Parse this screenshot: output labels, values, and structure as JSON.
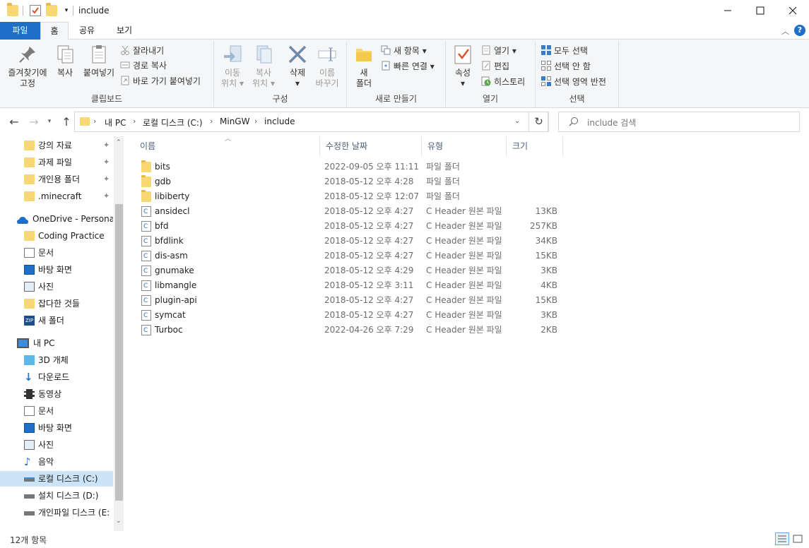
{
  "window": {
    "title": "include",
    "minimize_icon": "minimize-icon",
    "maximize_icon": "maximize-icon",
    "close_icon": "close-icon"
  },
  "ribbon_tabs": [
    {
      "label": "파일"
    },
    {
      "label": "홈"
    },
    {
      "label": "공유"
    },
    {
      "label": "보기"
    }
  ],
  "ribbon": {
    "clipboard": {
      "pin": "즐겨찾기에 고정",
      "pin_l1": "즐겨찾기에",
      "pin_l2": "고정",
      "copy": "복사",
      "paste": "붙여넣기",
      "cut": "잘라내기",
      "copy_path": "경로 복사",
      "paste_shortcut": "바로 가기 붙여넣기",
      "label": "클립보드"
    },
    "organize": {
      "move_l1": "이동",
      "move_l2": "위치",
      "copyto_l1": "복사",
      "copyto_l2": "위치",
      "delete": "삭제",
      "rename_l1": "이름",
      "rename_l2": "바꾸기",
      "label": "구성"
    },
    "new": {
      "folder_l1": "새",
      "folder_l2": "폴더",
      "new_item": "새 항목",
      "easy_access": "빠른 연결",
      "label": "새로 만들기"
    },
    "open": {
      "properties": "속성",
      "open": "열기",
      "edit": "편집",
      "history": "히스토리",
      "label": "열기"
    },
    "select": {
      "select_all": "모두 선택",
      "select_none": "선택 안 함",
      "invert": "선택 영역 반전",
      "label": "선택"
    }
  },
  "address": {
    "crumbs": [
      "내 PC",
      "로컬 디스크 (C:)",
      "MinGW",
      "include"
    ],
    "search_placeholder": "include 검색"
  },
  "nav": {
    "quick_access": [
      {
        "label": "강의 자료",
        "pinned": true
      },
      {
        "label": "과제 파일",
        "pinned": true
      },
      {
        "label": "개인용 폴더",
        "pinned": true
      },
      {
        "label": ".minecraft",
        "pinned": true
      }
    ],
    "onedrive": "OneDrive - Personal",
    "onedrive_items": [
      {
        "label": "Coding Practice",
        "icon": "folder-icon"
      },
      {
        "label": "문서",
        "icon": "document-icon"
      },
      {
        "label": "바탕 화면",
        "icon": "desktop-icon"
      },
      {
        "label": "사진",
        "icon": "pictures-icon"
      },
      {
        "label": "잡다한 것들",
        "icon": "folder-icon"
      },
      {
        "label": "새 폴더",
        "icon": "zip-folder-icon"
      }
    ],
    "this_pc": "내 PC",
    "pc_items": [
      {
        "label": "3D 개체",
        "icon": "3d-objects-icon"
      },
      {
        "label": "다운로드",
        "icon": "download-icon"
      },
      {
        "label": "동영상",
        "icon": "video-icon"
      },
      {
        "label": "문서",
        "icon": "document-icon"
      },
      {
        "label": "바탕 화면",
        "icon": "desktop-icon"
      },
      {
        "label": "사진",
        "icon": "pictures-icon"
      },
      {
        "label": "음악",
        "icon": "music-icon"
      },
      {
        "label": "로컬 디스크 (C:)",
        "icon": "drive-c-icon",
        "selected": true
      },
      {
        "label": "설치 디스크 (D:)",
        "icon": "drive-icon"
      },
      {
        "label": "개인파일 디스크 (E:",
        "icon": "drive-icon"
      }
    ]
  },
  "columns": {
    "name": "이름",
    "date": "수정한 날짜",
    "type": "유형",
    "size": "크기"
  },
  "files": [
    {
      "name": "bits",
      "date": "2022-09-05 오후 11:11",
      "type": "파일 폴더",
      "size": "",
      "kind": "folder"
    },
    {
      "name": "gdb",
      "date": "2018-05-12 오후 4:28",
      "type": "파일 폴더",
      "size": "",
      "kind": "folder"
    },
    {
      "name": "libiberty",
      "date": "2018-05-12 오후 12:07",
      "type": "파일 폴더",
      "size": "",
      "kind": "folder"
    },
    {
      "name": "ansidecl",
      "date": "2018-05-12 오후 4:27",
      "type": "C Header 원본 파일",
      "size": "13KB",
      "kind": "file"
    },
    {
      "name": "bfd",
      "date": "2018-05-12 오후 4:27",
      "type": "C Header 원본 파일",
      "size": "257KB",
      "kind": "file"
    },
    {
      "name": "bfdlink",
      "date": "2018-05-12 오후 4:27",
      "type": "C Header 원본 파일",
      "size": "34KB",
      "kind": "file"
    },
    {
      "name": "dis-asm",
      "date": "2018-05-12 오후 4:27",
      "type": "C Header 원본 파일",
      "size": "15KB",
      "kind": "file"
    },
    {
      "name": "gnumake",
      "date": "2018-05-12 오후 4:29",
      "type": "C Header 원본 파일",
      "size": "3KB",
      "kind": "file"
    },
    {
      "name": "libmangle",
      "date": "2018-05-12 오후 3:11",
      "type": "C Header 원본 파일",
      "size": "4KB",
      "kind": "file"
    },
    {
      "name": "plugin-api",
      "date": "2018-05-12 오후 4:27",
      "type": "C Header 원본 파일",
      "size": "15KB",
      "kind": "file"
    },
    {
      "name": "symcat",
      "date": "2018-05-12 오후 4:27",
      "type": "C Header 원본 파일",
      "size": "3KB",
      "kind": "file"
    },
    {
      "name": "Turboc",
      "date": "2022-04-26 오후 7:29",
      "type": "C Header 원본 파일",
      "size": "2KB",
      "kind": "file"
    }
  ],
  "status": {
    "count": "12개 항목"
  },
  "colors": {
    "accent": "#1e6fc6",
    "folder": "#f8d775",
    "selection": "#cce4f7"
  }
}
